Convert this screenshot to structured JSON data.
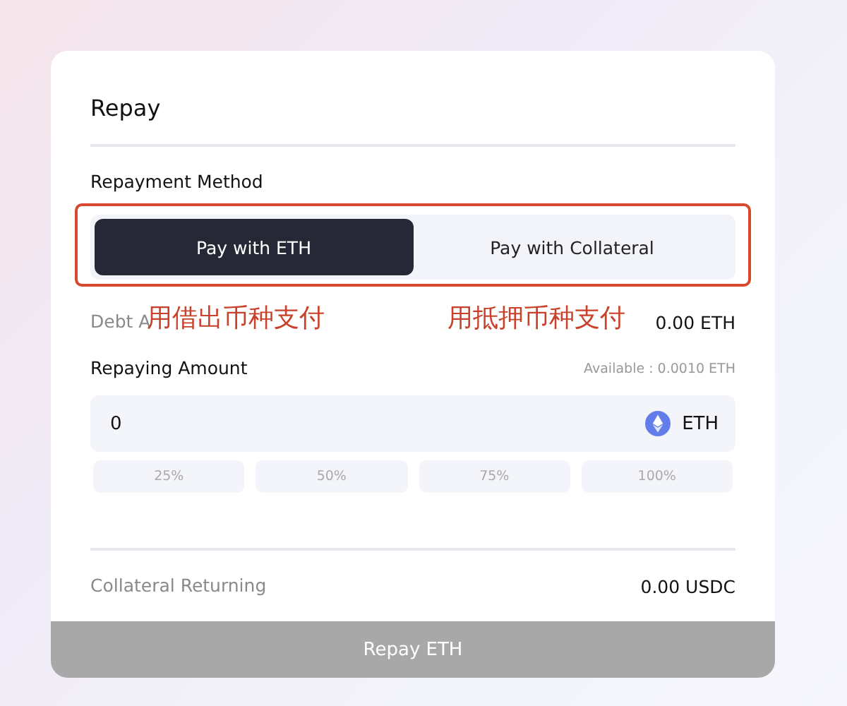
{
  "dialog": {
    "title": "Repay"
  },
  "method": {
    "label": "Repayment Method",
    "options": [
      {
        "label": "Pay with ETH",
        "selected": true
      },
      {
        "label": "Pay with Collateral",
        "selected": false
      }
    ]
  },
  "debt": {
    "label": "Debt A",
    "value": "0.00 ETH"
  },
  "repaying": {
    "label": "Repaying Amount",
    "available": "Available : 0.0010 ETH",
    "value": "0",
    "token": "ETH",
    "presets": [
      "25%",
      "50%",
      "75%",
      "100%"
    ]
  },
  "collateral_returning": {
    "label": "Collateral Returning",
    "value": "0.00 USDC"
  },
  "submit": {
    "label": "Repay ETH",
    "disabled": true
  },
  "annotations": [
    {
      "text": "用借出币种支付"
    },
    {
      "text": "用抵押币种支付"
    }
  ]
}
